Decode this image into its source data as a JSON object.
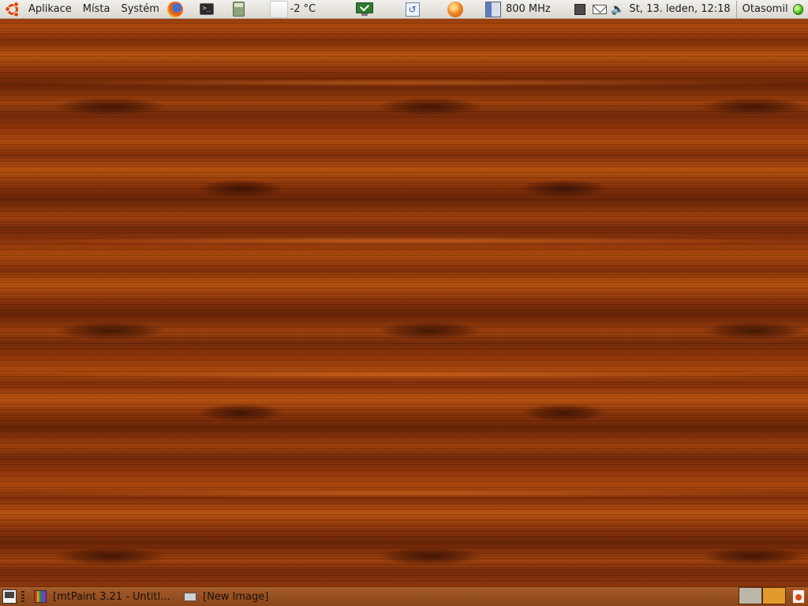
{
  "top_panel": {
    "menus": [
      "Aplikace",
      "Místa",
      "Systém"
    ],
    "weather": "-2 °C",
    "cpu_frequency": "800 MHz",
    "clock": "St, 13. leden, 12:18",
    "user": "Otasomil"
  },
  "launchers": [
    "firefox-icon",
    "terminal-icon",
    "calculator-icon"
  ],
  "bottom_panel": {
    "tasks": [
      {
        "label": "[mtPaint 3.21 - Untitl...",
        "icon": "mtpaint-icon"
      },
      {
        "label": "[New Image]",
        "icon": "image-icon"
      }
    ],
    "workspaces": 2
  },
  "colors": {
    "panel": "#dcd8d0",
    "accent": "#dd4814",
    "wood": "#9a3a0c"
  }
}
